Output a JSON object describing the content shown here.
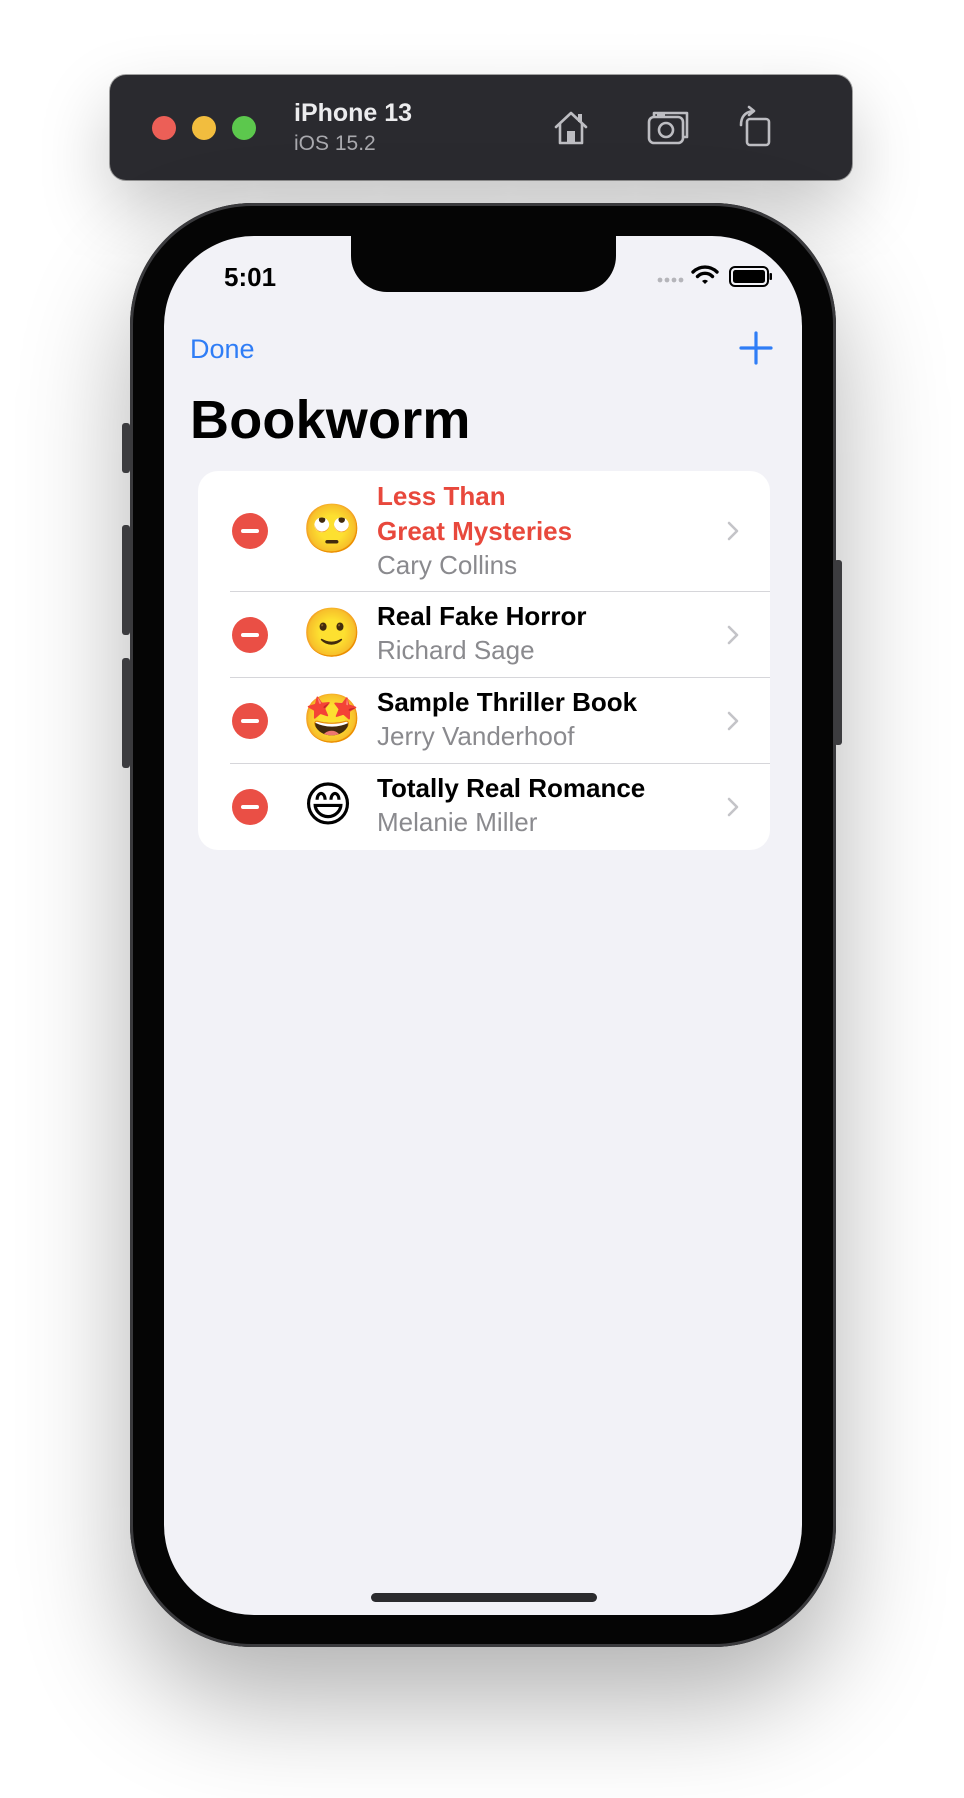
{
  "simulator": {
    "device_name": "iPhone 13",
    "os_version": "iOS 15.2",
    "tool_icons": [
      "home-icon",
      "screenshot-icon",
      "rotate-icon"
    ]
  },
  "status_bar": {
    "time": "5:01"
  },
  "nav": {
    "done_label": "Done",
    "add_icon": "plus-icon",
    "title": "Bookworm"
  },
  "books": [
    {
      "title_line1": "Less Than",
      "title_line2": "Great Mysteries",
      "author": "Cary Collins",
      "emoji": "🙄",
      "highlighted": true
    },
    {
      "title": "Real Fake Horror",
      "author": "Richard Sage",
      "emoji": "🙂"
    },
    {
      "title": "Sample Thriller Book",
      "author": "Jerry Vanderhoof",
      "emoji": "🤩"
    },
    {
      "title": "Totally Real Romance",
      "author": "Melanie Miller",
      "emoji": "😄"
    }
  ],
  "colors": {
    "accent": "#2f7df6",
    "delete": "#ea4f45",
    "low_rating_title": "#e8483c",
    "background": "#f2f2f7"
  }
}
